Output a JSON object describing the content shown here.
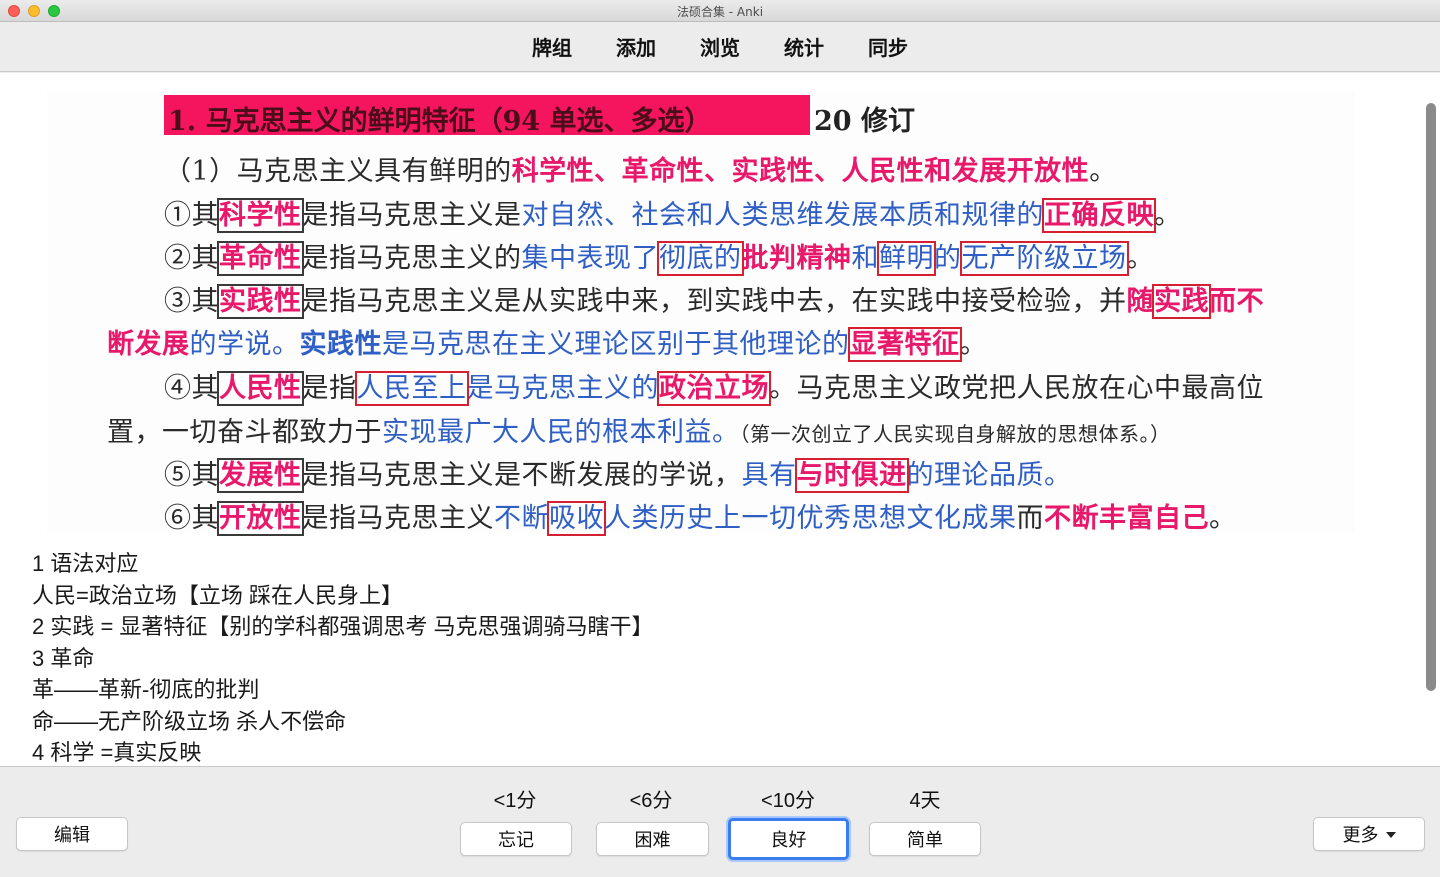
{
  "window": {
    "title": "法硕合集 - Anki"
  },
  "toolbar": {
    "items": [
      "牌组",
      "添加",
      "浏览",
      "统计",
      "同步"
    ]
  },
  "note": {
    "heading": "1. 马克思主义的鲜明特征（94 单选、多选）",
    "heading_suffix": "20 修订",
    "intro": {
      "pre": "（1）马克思主义具有鲜明的",
      "highlight": "科学性、革命性、实践性、人民性和发展开放性",
      "post": "。"
    },
    "lines": [
      {
        "a": "①其",
        "b": "科学性",
        "c": "是指马克思主义是",
        "d": "对自然、社会和人类思维发展本质和规律的",
        "e": "正确反映",
        "f": "。"
      },
      {
        "a": "②其",
        "b": "革命性",
        "c": "是指马克思主义的",
        "d": "集中表现了",
        "e": "彻底的",
        "g": "批判精神",
        "h": "和",
        "i": "鲜明",
        "j": "的",
        "k": "无产阶级立场",
        "f": "。"
      },
      {
        "a": "③其",
        "b": "实践性",
        "c": "是指马克思主义是从实践中来，到实践中去，在实践中接受检验，并",
        "e": "随",
        "g": "实践",
        "h": "而不"
      },
      {
        "a": "断发展",
        "c": "的学说。",
        "b": "实践性",
        "d": "是马克思在主义理论区别于其他理论的",
        "e": "显著特征",
        "f": "。"
      },
      {
        "a": "④其",
        "b": "人民性",
        "c": "是指",
        "d": "人民至上",
        "e": "是马克思主义的",
        "g": "政治立场",
        "f": "。马克思主义政党把人民放在心中最高位"
      },
      {
        "a": "置，一切奋斗都致力于",
        "d": "实现最广大人民的根本利益",
        "f": "。",
        "s": "（第一次创立了人民实现自身解放的思想体系。）"
      },
      {
        "a": "⑤其",
        "b": "发展性",
        "c": "是指马克思主义是不断发展的学说，",
        "d": "具有",
        "e": "与时俱进",
        "g": "的理论品质",
        "f": "。"
      },
      {
        "a": "⑥其",
        "b": "开放性",
        "c": "是指马克思主义",
        "d": "不断",
        "e": "吸收",
        "g": "人类历史上一切优秀思想文化成果",
        "h": "而",
        "i": "不断丰富自己",
        "f": "。"
      }
    ]
  },
  "answer_lines": [
    "1 语法对应",
    "人民=政治立场【立场 踩在人民身上】",
    "2 实践 = 显著特征【别的学科都强调思考 马克思强调骑马瞎干】",
    "3 革命",
    "革——革新-彻底的批判",
    "命——无产阶级立场 杀人不偿命",
    "4 科学 =真实反映"
  ],
  "bottom": {
    "edit_label": "编辑",
    "more_label": "更多",
    "ease": [
      {
        "time": "<1分",
        "label": "忘记"
      },
      {
        "time": "<6分",
        "label": "困难"
      },
      {
        "time": "<10分",
        "label": "良好"
      },
      {
        "time": "4天",
        "label": "简单"
      }
    ]
  },
  "colors": {
    "accent": "#3b7df0",
    "highlight_pink": "#e8186a",
    "note_blue": "#2f5fc4",
    "box_red": "#d42030"
  }
}
